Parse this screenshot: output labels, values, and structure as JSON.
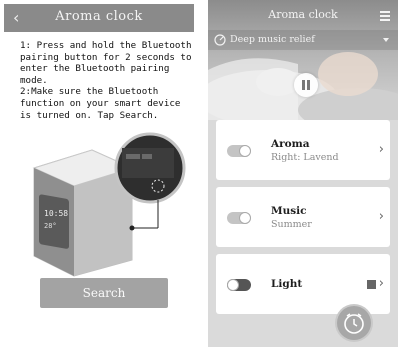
{
  "left": {
    "header": {
      "back_icon": "‹",
      "title": "Aroma clock"
    },
    "instructions": {
      "step1": "1: Press and hold the Bluetooth pairing button for 2 seconds to enter the Bluetooth pairing mode.",
      "step2": "2:Make sure the Bluetooth function on your smart device is turned on. Tap Search."
    },
    "device_display": {
      "line1": "10:58",
      "line2": "28°"
    },
    "search_label": "Search"
  },
  "right": {
    "header": {
      "title": "Aroma clock"
    },
    "music_bar": {
      "label": "Deep music relief"
    },
    "cards": [
      {
        "title": "Aroma",
        "subtitle": "Right: Lavend",
        "toggle": "on"
      },
      {
        "title": "Music",
        "subtitle": "Summer",
        "toggle": "on"
      },
      {
        "title": "Light",
        "subtitle": "",
        "toggle": "off"
      }
    ]
  },
  "colors": {
    "header_gray": "#8a8a8a",
    "button_gray": "#a3a3a3",
    "panel_bg": "#dadada"
  }
}
